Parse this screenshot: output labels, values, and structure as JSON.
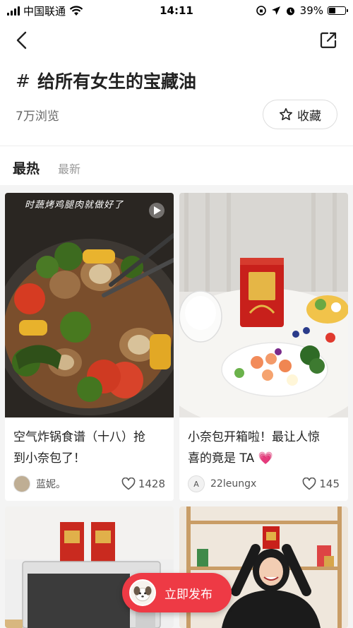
{
  "status_bar": {
    "carrier": "中国联通",
    "time": "14:11",
    "battery": "39%",
    "battery_level": 0.39
  },
  "topic": {
    "hash": "#",
    "title": "给所有女生的宝藏油",
    "views": "7万浏览",
    "favorite_label": "收藏"
  },
  "tabs": [
    {
      "label": "最热",
      "active": true
    },
    {
      "label": "最新",
      "active": false
    }
  ],
  "posts": [
    {
      "image_caption": "时蔬烤鸡腿肉就做好了",
      "title_line1": "空气炸锅食谱（十八）抢",
      "title_line2": "到小奈包了！",
      "author": "蓝妮。",
      "likes": "1428",
      "icon": "heart-icon"
    },
    {
      "title_line1": "小奈包开箱啦！最让人惊",
      "title_line2": "喜的竟是 TA",
      "title_emoji": "💗",
      "author": "22leungx",
      "avatar_letter": "A",
      "likes": "145",
      "icon": "heart-icon"
    },
    {},
    {}
  ],
  "publish_button": {
    "label": "立即发布"
  },
  "colors": {
    "accent": "#ee3a45",
    "feed_bg": "#f4f4f4",
    "text_primary": "#222222",
    "text_secondary": "#999999"
  }
}
